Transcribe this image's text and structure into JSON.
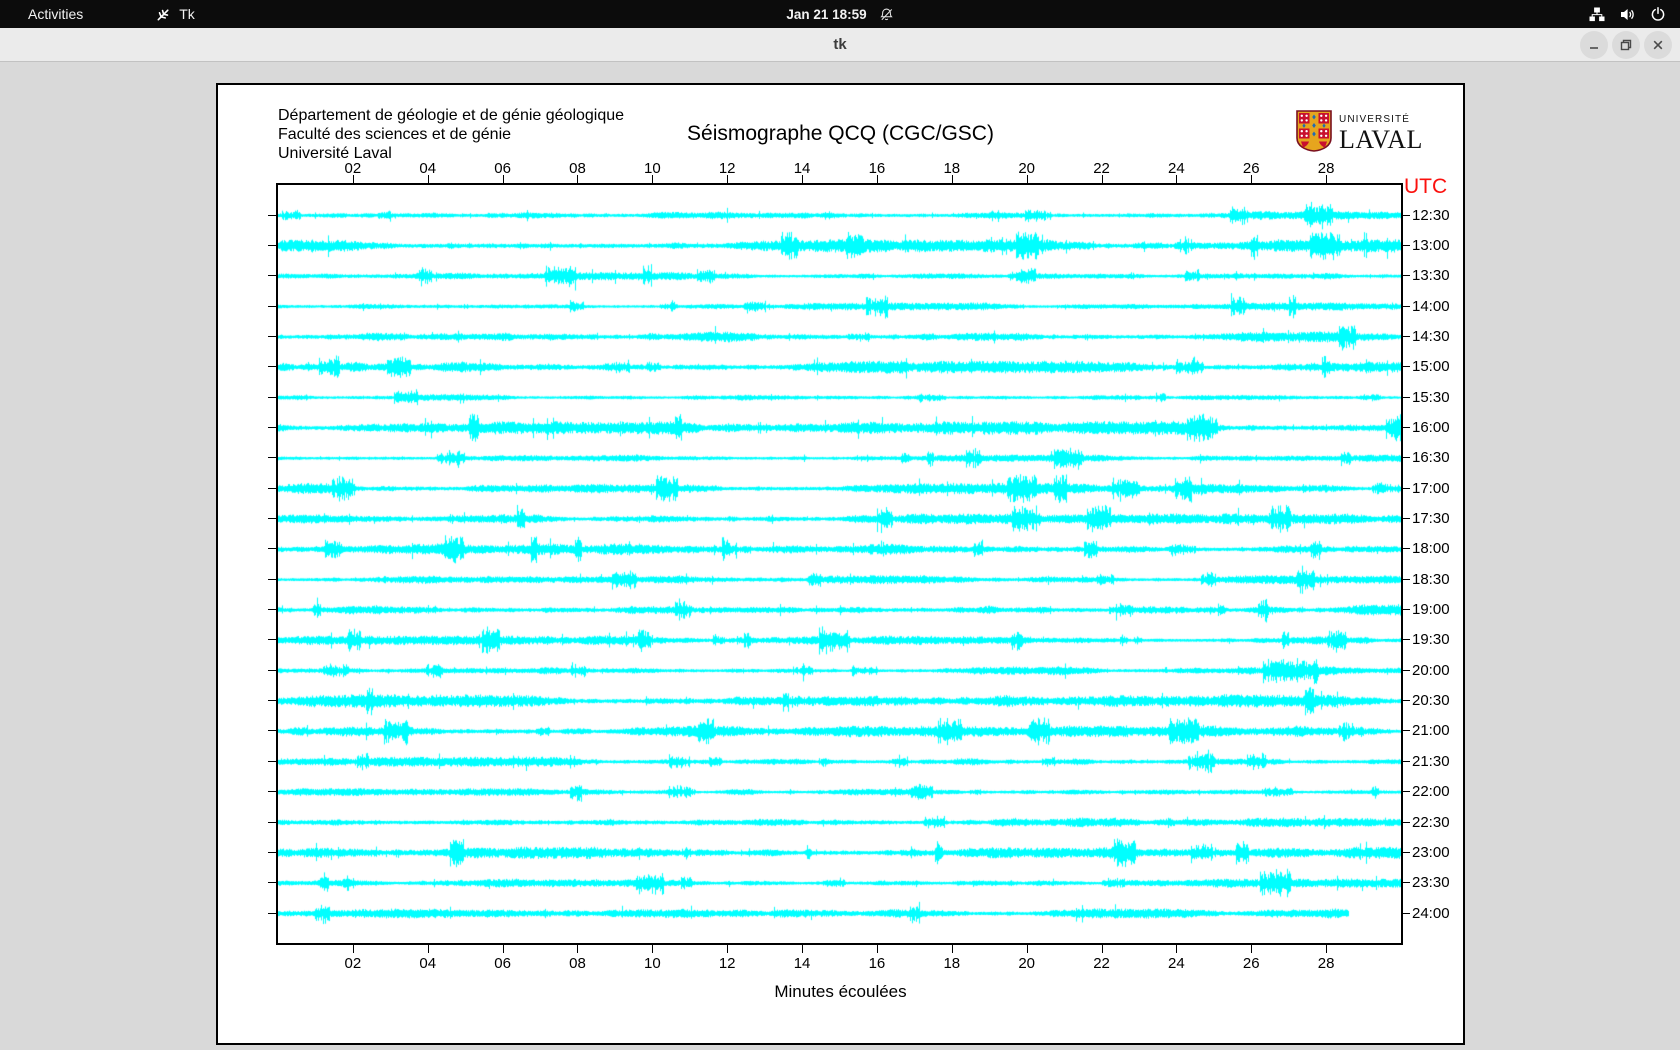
{
  "topbar": {
    "activities_label": "Activities",
    "app_name": "Tk",
    "clock": "Jan 21 18:59",
    "icons": [
      "tk-feather-icon",
      "notifications-muted-icon",
      "network-icon",
      "volume-icon",
      "power-icon"
    ]
  },
  "titlebar": {
    "title": "tk",
    "buttons": [
      "minimize",
      "restore",
      "close"
    ]
  },
  "page": {
    "header_lines": "Département de géologie et de génie géologique\nFaculté des sciences et de génie\nUniversité Laval",
    "title": "Séismographe QCQ (CGC/GSC)",
    "logo": {
      "line1": "UNIVERSITÉ",
      "line2": "LAVAL"
    },
    "utc_label": "UTC",
    "xlabel": "Minutes écoulées"
  },
  "chart_data": {
    "type": "line",
    "subtype": "seismograph_helicorder",
    "station": "QCQ (CGC/GSC)",
    "x_axis_label": "Minutes écoulées",
    "x_range_minutes": [
      0,
      30
    ],
    "x_tick_labels": [
      "02",
      "04",
      "06",
      "08",
      "10",
      "12",
      "14",
      "16",
      "18",
      "20",
      "22",
      "24",
      "26",
      "28"
    ],
    "trace_interval_minutes": 30,
    "trace_utc_times": [
      "12:30",
      "13:00",
      "13:30",
      "14:00",
      "14:30",
      "15:00",
      "15:30",
      "16:00",
      "16:30",
      "17:00",
      "17:30",
      "18:00",
      "18:30",
      "19:00",
      "19:30",
      "20:00",
      "20:30",
      "21:00",
      "21:30",
      "22:00",
      "22:30",
      "23:00",
      "23:30",
      "24:00"
    ],
    "last_trace_end_minute": 28.6,
    "trace_color": "#00ffff",
    "note": "continuous background seismic noise with intermittent bursts; amplitude scale not labeled"
  },
  "colors": {
    "topbar_bg": "#0c0c0c",
    "titlebar_bg": "#ebebeb",
    "window_bg": "#d9d9d9",
    "canvas_bg": "#ffffff",
    "trace": "#00ffff",
    "utc_red": "#fb100d"
  }
}
